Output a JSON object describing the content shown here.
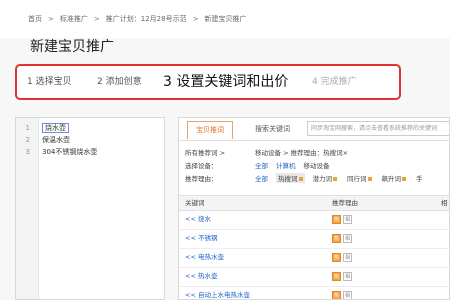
{
  "breadcrumb": {
    "home": "首页",
    "item2": "标准推广",
    "item3": "推广计划：12月28号示范",
    "item4": "新建宝贝推广"
  },
  "page_title": "新建宝贝推广",
  "steps": [
    {
      "label": "1 选择宝贝",
      "state": "done"
    },
    {
      "label": "2 添加创意",
      "state": "done"
    },
    {
      "label": "3 设置关键词和出价",
      "state": "current"
    },
    {
      "label": "4 完成推广",
      "state": "pending"
    }
  ],
  "keyword_editor": {
    "lines": [
      {
        "num": "1",
        "text": "烧水壶"
      },
      {
        "num": "2",
        "text": "保温水壶"
      },
      {
        "num": "3",
        "text": "304不锈钢烧水壶"
      }
    ]
  },
  "tabs": {
    "active": "宝贝推词",
    "other": "搜索关键词",
    "search_placeholder": "同步淘宝网搜索，请点击查看系统推荐的关键词"
  },
  "filters": {
    "all_recommend_label": "所有推荐词 >",
    "device_text": "移动设备 > 推荐理由：热搜词×",
    "device_label": "选择设备：",
    "device_options": [
      "全部",
      "计算机",
      "移动设备"
    ],
    "reason_label": "推荐理由：",
    "reason_options": [
      "全部",
      "热搜词",
      "潜力词",
      "同行词",
      "飙升词",
      "手"
    ]
  },
  "table": {
    "headers": [
      "关键词",
      "推荐理由",
      "相"
    ],
    "rows": [
      {
        "link": "<< 烧水",
        "badge1": "热",
        "badge2": "相"
      },
      {
        "link": "<< 不锈钢",
        "badge1": "热",
        "badge2": "相"
      },
      {
        "link": "<< 电热水壶",
        "badge1": "热",
        "badge2": "相"
      },
      {
        "link": "<< 热水壶",
        "badge1": "热",
        "badge2": "相"
      },
      {
        "link": "<< 自动上水电热水壶",
        "badge1": "热",
        "badge2": "相"
      }
    ]
  },
  "colors": {
    "highlight_border": "#e0332f",
    "tab_active": "#e8731d",
    "link": "#1a62c4",
    "badge_heat": "#f4a245"
  }
}
